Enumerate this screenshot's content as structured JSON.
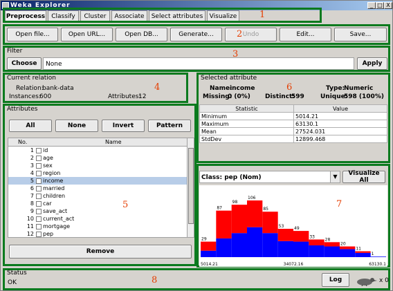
{
  "window": {
    "title": "Weka Explorer",
    "minimize": "_",
    "maximize": "□",
    "close": "X"
  },
  "tabs": [
    "Preprocess",
    "Classify",
    "Cluster",
    "Associate",
    "Select attributes",
    "Visualize"
  ],
  "toolbar": {
    "open_file": "Open file...",
    "open_url": "Open URL...",
    "open_db": "Open DB...",
    "generate": "Generate...",
    "undo": "Undo",
    "edit": "Edit...",
    "save": "Save..."
  },
  "filter": {
    "title": "Filter",
    "choose": "Choose",
    "value": "None",
    "apply": "Apply"
  },
  "current_relation": {
    "title": "Current relation",
    "relation_label": "Relation:",
    "relation": "bank-data",
    "instances_label": "Instances:",
    "instances": "600",
    "attributes_label": "Attributes:",
    "attributes": "12"
  },
  "attributes": {
    "title": "Attributes",
    "buttons": [
      "All",
      "None",
      "Invert",
      "Pattern"
    ],
    "col_no": "No.",
    "col_name": "Name",
    "rows": [
      {
        "no": "1",
        "name": "id"
      },
      {
        "no": "2",
        "name": "age"
      },
      {
        "no": "3",
        "name": "sex"
      },
      {
        "no": "4",
        "name": "region"
      },
      {
        "no": "5",
        "name": "income"
      },
      {
        "no": "6",
        "name": "married"
      },
      {
        "no": "7",
        "name": "children"
      },
      {
        "no": "8",
        "name": "car"
      },
      {
        "no": "9",
        "name": "save_act"
      },
      {
        "no": "10",
        "name": "current_act"
      },
      {
        "no": "11",
        "name": "mortgage"
      },
      {
        "no": "12",
        "name": "pep"
      }
    ],
    "remove": "Remove"
  },
  "selected_attribute": {
    "title": "Selected attribute",
    "name_label": "Name:",
    "name": "income",
    "type_label": "Type:",
    "type": "Numeric",
    "missing_label": "Missing:",
    "missing": "0 (0%)",
    "distinct_label": "Distinct:",
    "distinct": "599",
    "unique_label": "Unique:",
    "unique": "598 (100%)",
    "col_statistic": "Statistic",
    "col_value": "Value",
    "stats": [
      {
        "stat": "Minimum",
        "value": "5014.21"
      },
      {
        "stat": "Maximum",
        "value": "63130.1"
      },
      {
        "stat": "Mean",
        "value": "27524.031"
      },
      {
        "stat": "StdDev",
        "value": "12899.468"
      }
    ]
  },
  "class_select": {
    "value": "Class: pep (Nom)",
    "visualize_all": "Visualize All"
  },
  "chart_data": {
    "type": "bar",
    "stacked": true,
    "categories": [
      "1",
      "2",
      "3",
      "4",
      "5",
      "6",
      "7",
      "8",
      "9",
      "10",
      "11",
      "12"
    ],
    "totals": [
      29,
      87,
      98,
      106,
      85,
      53,
      49,
      33,
      28,
      20,
      11,
      1
    ],
    "series": [
      {
        "color": "#0000ff",
        "values": [
          12,
          35,
          45,
          56,
          45,
          30,
          29,
          22,
          20,
          15,
          8,
          1
        ]
      },
      {
        "color": "#ff0000",
        "values": [
          17,
          52,
          53,
          50,
          40,
          23,
          20,
          11,
          8,
          5,
          3,
          0
        ]
      }
    ],
    "x_tick_labels": [
      "5014.21",
      "34072.16",
      "63130.1"
    ],
    "ymax": 106
  },
  "status": {
    "title": "Status",
    "text": "OK",
    "log": "Log",
    "count": "x 0"
  },
  "annotations": [
    "1",
    "2",
    "3",
    "4",
    "5",
    "6",
    "7",
    "8"
  ]
}
